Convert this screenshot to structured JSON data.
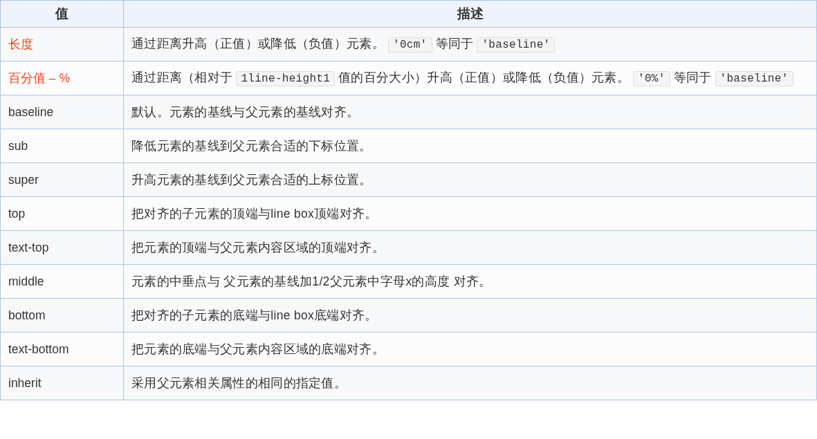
{
  "table": {
    "columns": [
      "值",
      "描述"
    ],
    "rows": [
      {
        "value": "长度",
        "highlighted": true,
        "description": [
          {
            "kind": "text",
            "text": "通过距离升高（正值）或降低（负值）元素。"
          },
          {
            "kind": "code",
            "text": "'0cm'"
          },
          {
            "kind": "text",
            "text": "等同于"
          },
          {
            "kind": "code",
            "text": "'baseline'"
          }
        ]
      },
      {
        "value": "百分值 – %",
        "highlighted": true,
        "description": [
          {
            "kind": "text",
            "text": "通过距离（相对于"
          },
          {
            "kind": "code",
            "text": "1line-height1"
          },
          {
            "kind": "text",
            "text": "值的百分大小）升高（正值）或降低（负值）元素。"
          },
          {
            "kind": "code",
            "text": "'0%'"
          },
          {
            "kind": "text",
            "text": "等同于"
          },
          {
            "kind": "code",
            "text": "'baseline'"
          }
        ]
      },
      {
        "value": "baseline",
        "highlighted": false,
        "description": [
          {
            "kind": "text",
            "text": "默认。元素的基线与父元素的基线对齐。"
          }
        ]
      },
      {
        "value": "sub",
        "highlighted": false,
        "description": [
          {
            "kind": "text",
            "text": "降低元素的基线到父元素合适的下标位置。"
          }
        ]
      },
      {
        "value": "super",
        "highlighted": false,
        "description": [
          {
            "kind": "text",
            "text": "升高元素的基线到父元素合适的上标位置。"
          }
        ]
      },
      {
        "value": "top",
        "highlighted": false,
        "description": [
          {
            "kind": "text",
            "text": "把对齐的子元素的顶端与line box顶端对齐。"
          }
        ]
      },
      {
        "value": "text-top",
        "highlighted": false,
        "description": [
          {
            "kind": "text",
            "text": "把元素的顶端与父元素内容区域的顶端对齐。"
          }
        ]
      },
      {
        "value": "middle",
        "highlighted": false,
        "description": [
          {
            "kind": "text",
            "text": "元素的中垂点与 父元素的基线加1/2父元素中字母x的高度 对齐。"
          }
        ]
      },
      {
        "value": "bottom",
        "highlighted": false,
        "description": [
          {
            "kind": "text",
            "text": "把对齐的子元素的底端与line box底端对齐。"
          }
        ]
      },
      {
        "value": "text-bottom",
        "highlighted": false,
        "description": [
          {
            "kind": "text",
            "text": "把元素的底端与父元素内容区域的底端对齐。"
          }
        ]
      },
      {
        "value": "inherit",
        "highlighted": false,
        "description": [
          {
            "kind": "text",
            "text": "采用父元素相关属性的相同的指定值。"
          }
        ]
      }
    ]
  }
}
